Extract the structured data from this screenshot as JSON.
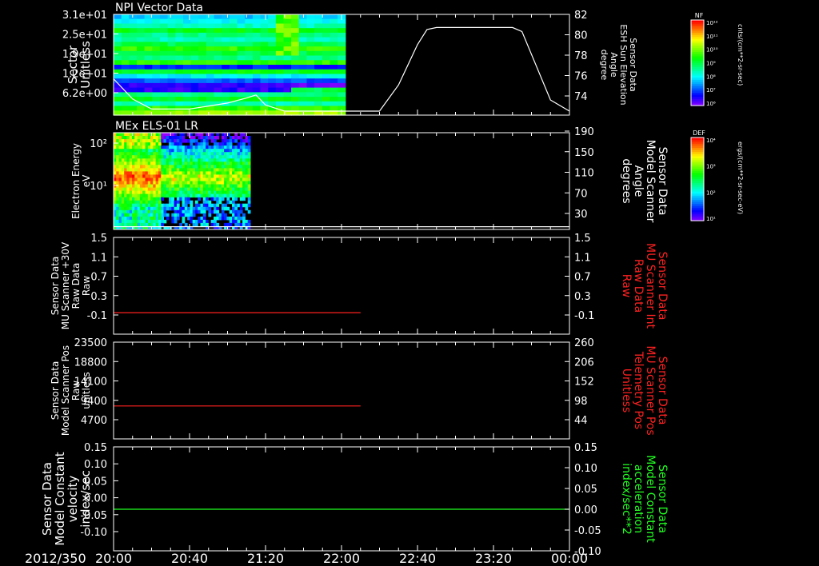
{
  "date_label": "2012/350",
  "time_axis": {
    "start": "20:00",
    "end": "00:00",
    "tick_labels": [
      "20:00",
      "20:40",
      "21:20",
      "22:00",
      "22:40",
      "23:20",
      "00:00"
    ],
    "minor_step_minutes": 10
  },
  "panels": [
    {
      "title": "NPI Vector Data",
      "left_label": [
        "Sector",
        "Unitless"
      ],
      "left_ticks": [
        "3.1e+01",
        "2.5e+01",
        "1.9e+01",
        "1.2e+01",
        "6.2e+00"
      ],
      "right_label": [
        "Sensor Data",
        "ESH Sun Elevation",
        "Angle",
        "degree"
      ],
      "right_label_color": "#ffffff",
      "right_ticks": [
        "82",
        "80",
        "78",
        "76",
        "74"
      ],
      "colorbar": {
        "badge": "NF",
        "unit": "cnts/(cm**2-sr-sec)",
        "tick_labels": [
          "10¹²",
          "10¹¹",
          "10¹⁰",
          "10⁹",
          "10⁸",
          "10⁷",
          "10⁶"
        ]
      }
    },
    {
      "title": "MEx ELS-01 LR",
      "left_label": [
        "Electron Energy",
        "eV"
      ],
      "left_ticks": [
        "10²",
        "10¹"
      ],
      "right_label": [
        "Sensor Data",
        "Model Scanner",
        "Angle",
        "degrees"
      ],
      "right_label_color": "#ffffff",
      "right_ticks": [
        "190",
        "150",
        "110",
        "70",
        "30"
      ],
      "colorbar": {
        "badge": "DEF",
        "unit": "ergs/(cm**2-sr-sec-eV)",
        "tick_labels": [
          "10⁴",
          "10³",
          "10²",
          "10¹"
        ]
      }
    },
    {
      "title": "",
      "left_label": [
        "Sensor Data",
        "MU Scanner +30V",
        "Raw Data",
        "Raw"
      ],
      "left_ticks": [
        "1.5",
        "1.1",
        "0.7",
        "0.3",
        "-0.1"
      ],
      "right_label": [
        "Sensor Data",
        "MU Scanner Int",
        "Raw Data",
        "Raw"
      ],
      "right_label_color": "#ff2020",
      "right_ticks": [
        "1.5",
        "1.1",
        "0.7",
        "0.3",
        "-0.1"
      ]
    },
    {
      "title": "",
      "left_label": [
        "Sensor Data",
        "Model Scanner Pos",
        "Raw",
        "unitless"
      ],
      "left_ticks": [
        "23500",
        "18800",
        "14100",
        "9400",
        "4700"
      ],
      "right_label": [
        "Sensor Data",
        "MU Scanner Pos",
        "Telemetry Pos",
        "Unitless"
      ],
      "right_label_color": "#ff2020",
      "right_ticks": [
        "260",
        "206",
        "152",
        "98",
        "44"
      ]
    },
    {
      "title": "",
      "left_label": [
        "Sensor Data",
        "Model Constant",
        "velocity",
        "index/sec"
      ],
      "left_ticks": [
        "0.15",
        "0.10",
        "0.05",
        "0.00",
        "-0.05",
        "-0.10"
      ],
      "right_label": [
        "Sensor Data",
        "Model Constant",
        "acceleration",
        "index/sec**2"
      ],
      "right_label_color": "#20ff20",
      "right_ticks": [
        "0.15",
        "0.10",
        "0.05",
        "0.00",
        "-0.05",
        "-0.10"
      ]
    }
  ],
  "chart_data": [
    {
      "type": "heatmap",
      "title": "NPI Vector Data",
      "x_range": [
        "20:00",
        "00:00"
      ],
      "ylim": [
        0,
        31
      ],
      "y_ticks": [
        "3.1e+01",
        "2.5e+01",
        "1.9e+01",
        "1.2e+01",
        "6.2e+00"
      ],
      "heatmap_x_end": "22:02",
      "overlay_line": {
        "axis": "right",
        "ylim": [
          72,
          82
        ],
        "points": [
          [
            "20:00",
            75.6
          ],
          [
            "20:10",
            73.6
          ],
          [
            "20:20",
            72.6
          ],
          [
            "20:40",
            72.6
          ],
          [
            "21:00",
            73.2
          ],
          [
            "21:10",
            73.7
          ],
          [
            "21:15",
            74.0
          ],
          [
            "21:20",
            73.0
          ],
          [
            "21:30",
            72.4
          ],
          [
            "22:00",
            72.4
          ],
          [
            "22:20",
            72.4
          ],
          [
            "22:30",
            75.0
          ],
          [
            "22:40",
            79.0
          ],
          [
            "22:45",
            80.5
          ],
          [
            "22:50",
            80.7
          ],
          [
            "23:30",
            80.7
          ],
          [
            "23:35",
            80.3
          ],
          [
            "23:50",
            73.5
          ],
          [
            "24:00",
            72.4
          ]
        ]
      }
    },
    {
      "type": "heatmap",
      "title": "MEx ELS-01 LR",
      "x_range": [
        "20:00",
        "00:00"
      ],
      "y_ticks": [
        "10²",
        "10¹"
      ],
      "heatmap_x_end": "21:12",
      "overlay_line": {
        "axis": "right",
        "ylim": [
          10,
          190
        ],
        "points": [
          [
            "20:00",
            15
          ],
          [
            "24:00",
            15
          ]
        ]
      }
    },
    {
      "type": "line",
      "ylim": [
        -0.3,
        1.5
      ],
      "series": [
        {
          "color": "#ff2020",
          "points": [
            [
              "20:00",
              0.1
            ],
            [
              "22:10",
              0.1
            ]
          ]
        }
      ]
    },
    {
      "type": "line",
      "ylim": [
        0,
        23500
      ],
      "series": [
        {
          "color": "#ff2020",
          "points": [
            [
              "20:00",
              8000
            ],
            [
              "22:10",
              8000
            ]
          ]
        }
      ]
    },
    {
      "type": "line",
      "ylim": [
        -0.1,
        0.15
      ],
      "series": [
        {
          "color": "#20ff20",
          "points": [
            [
              "20:00",
              0.0
            ],
            [
              "24:00",
              0.0
            ]
          ]
        }
      ]
    }
  ]
}
